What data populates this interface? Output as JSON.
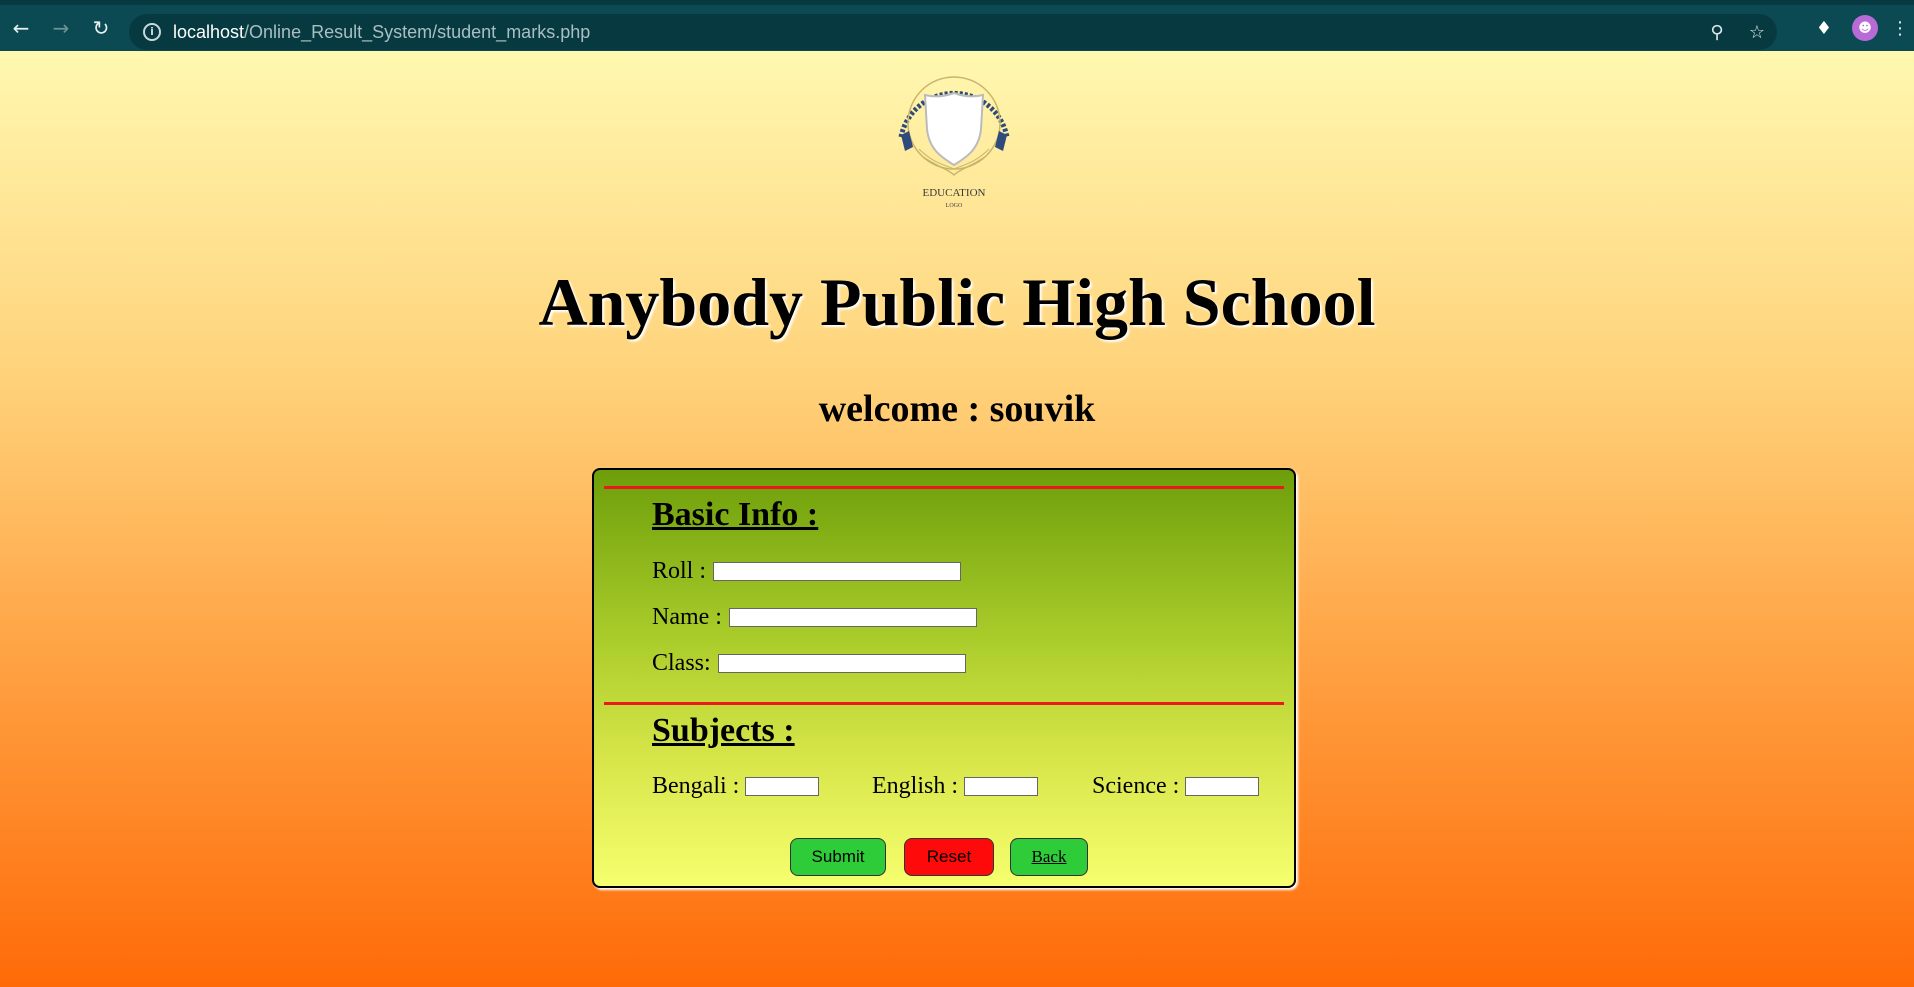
{
  "browser": {
    "url_host": "localhost",
    "url_path": "/Online_Result_System/student_marks.php"
  },
  "logo": {
    "line1": "EDUCATION",
    "line2": "LOGO"
  },
  "page": {
    "school_name": "Anybody Public High School",
    "welcome": "welcome : souvik"
  },
  "form": {
    "basic_info_heading": "Basic Info :",
    "roll_label": "Roll :",
    "name_label": "Name :",
    "class_label": "Class:",
    "roll_value": "",
    "name_value": "",
    "class_value": "",
    "subjects_heading": "Subjects :",
    "subjects": [
      {
        "label": "Bengali :",
        "value": ""
      },
      {
        "label": "English :",
        "value": ""
      },
      {
        "label": "Science :",
        "value": ""
      }
    ],
    "submit_label": "Submit",
    "reset_label": "Reset",
    "back_label": "Back"
  },
  "colors": {
    "chrome": "#0b4a52",
    "separator": "#e81a1a",
    "submit_bg": "#2fcc3a",
    "reset_bg": "#ff0a0a"
  }
}
